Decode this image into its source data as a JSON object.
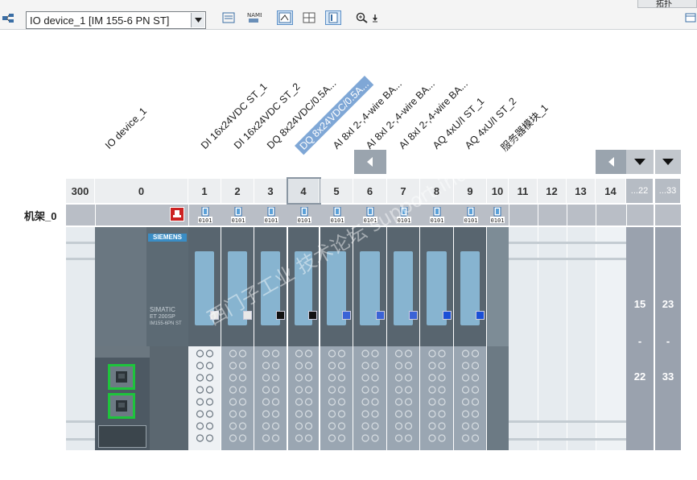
{
  "toolbar": {
    "device_select_value": "IO device_1 [IM 155-6 PN ST]",
    "top_right_text": "拓扑"
  },
  "module_labels": [
    "IO device_1",
    "DI 16x24VDC ST_1",
    "DI 16x24VDC ST_2",
    "DQ 8x24VDC/0.5A...",
    "DQ 8x24VDC/0.5A...",
    "AI 8xI 2-,4-wire BA...",
    "AI 8xI 2-,4-wire BA...",
    "AI 8xI 2-,4-wire BA...",
    "AQ 4xU/I ST_1",
    "AQ 4xU/I ST_2",
    "服务器模块_1"
  ],
  "slots": [
    "300",
    "0",
    "1",
    "2",
    "3",
    "4",
    "5",
    "6",
    "7",
    "8",
    "9",
    "10",
    "11",
    "12",
    "13",
    "14",
    "...22",
    "...33"
  ],
  "rack": {
    "label": "机架_0"
  },
  "module_brand": "SIEMENS",
  "head_text": [
    "SIMATIC",
    "ET 200SP",
    "IM155-6PN ST"
  ],
  "io_badge": "0101",
  "range_columns": [
    {
      "start": "15",
      "sep": "-",
      "end": "22"
    },
    {
      "start": "23",
      "sep": "-",
      "end": "33"
    }
  ],
  "watermark": "西门子工业 技术论坛 support.industry.siemens.com.cn",
  "colors": {
    "module_body": "#58656f",
    "capsule": "#87b4d0",
    "port_green": "#1ec43c",
    "selected_label": "#7fa7d6",
    "slot_gray": "#b6bcc4"
  }
}
